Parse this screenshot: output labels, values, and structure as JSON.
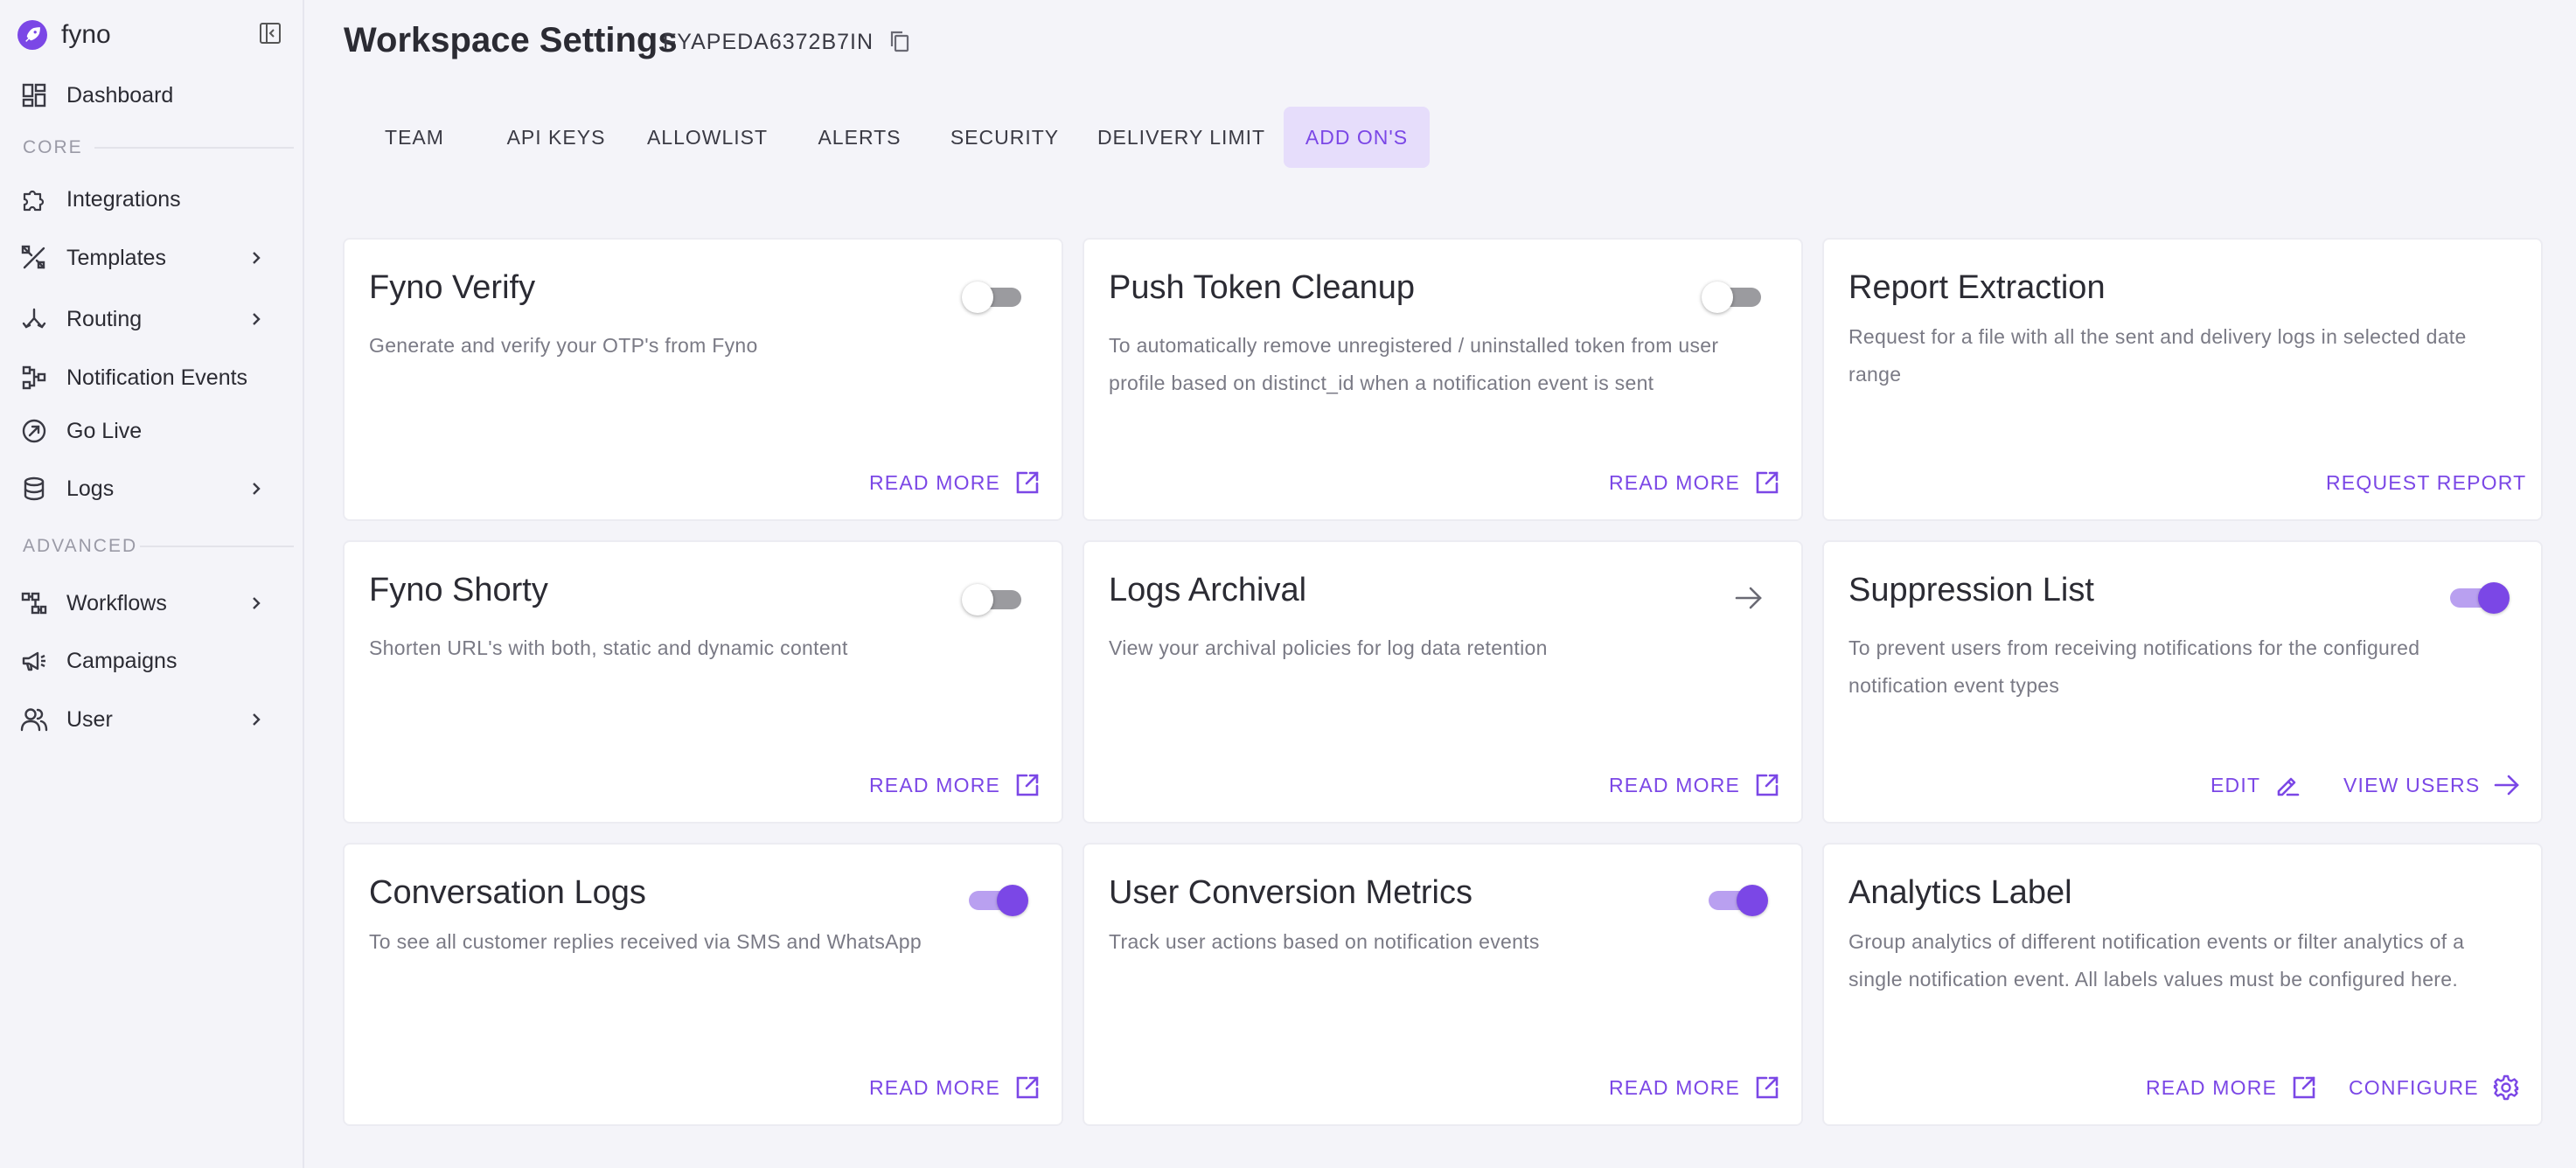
{
  "brand": {
    "name": "fyno"
  },
  "sidebar": {
    "items_core_header": "CORE",
    "items_advanced_header": "ADVANCED",
    "items": [
      {
        "label": "Dashboard",
        "icon": "dashboard-grid-icon"
      },
      {
        "label": "Integrations",
        "icon": "puzzle-icon"
      },
      {
        "label": "Templates",
        "icon": "tools-icon",
        "has_submenu": true
      },
      {
        "label": "Routing",
        "icon": "routing-fork-icon",
        "has_submenu": true
      },
      {
        "label": "Notification Events",
        "icon": "flow-icon"
      },
      {
        "label": "Go Live",
        "icon": "compass-arrow-icon"
      },
      {
        "label": "Logs",
        "icon": "database-icon",
        "has_submenu": true
      },
      {
        "label": "Workflows",
        "icon": "workflow-icon",
        "has_submenu": true
      },
      {
        "label": "Campaigns",
        "icon": "megaphone-icon"
      },
      {
        "label": "User",
        "icon": "users-icon",
        "has_submenu": true
      }
    ]
  },
  "header": {
    "title": "Workspace Settings",
    "workspace_id": "FYAPEDA6372B7IN"
  },
  "tabs": [
    {
      "label": "TEAM",
      "active": false
    },
    {
      "label": "API KEYS",
      "active": false
    },
    {
      "label": "ALLOWLIST",
      "active": false
    },
    {
      "label": "ALERTS",
      "active": false
    },
    {
      "label": "SECURITY",
      "active": false
    },
    {
      "label": "DELIVERY LIMIT",
      "active": false
    },
    {
      "label": "ADD ON'S",
      "active": true
    }
  ],
  "cards": [
    {
      "title": "Fyno Verify",
      "description": "Generate and verify your OTP's from Fyno",
      "toggle": false,
      "actions": [
        {
          "label": "READ MORE",
          "icon": "external-link-icon"
        }
      ]
    },
    {
      "title": "Push Token Cleanup",
      "description": "To automatically remove unregistered / uninstalled token from user profile based on distinct_id when a notification event is sent",
      "toggle": false,
      "actions": [
        {
          "label": "READ MORE",
          "icon": "external-link-icon"
        }
      ]
    },
    {
      "title": "Report Extraction",
      "description": "Request for a file with all the sent and delivery logs in selected date range",
      "actions": [
        {
          "label": "REQUEST REPORT"
        }
      ]
    },
    {
      "title": "Fyno Shorty",
      "description": "Shorten URL's with both, static and dynamic content",
      "toggle": false,
      "actions": [
        {
          "label": "READ MORE",
          "icon": "external-link-icon"
        }
      ]
    },
    {
      "title": "Logs Archival",
      "description": "View your archival policies for log data retention",
      "header_icon": "arrow-right-icon",
      "actions": [
        {
          "label": "READ MORE",
          "icon": "external-link-icon"
        }
      ]
    },
    {
      "title": "Suppression List",
      "description": "To prevent users from receiving notifications for the configured notification event types",
      "toggle": true,
      "actions": [
        {
          "label": "EDIT",
          "icon": "pencil-icon"
        },
        {
          "label": "VIEW USERS",
          "icon": "arrow-right-icon"
        }
      ]
    },
    {
      "title": "Conversation Logs",
      "description": "To see all customer replies received via SMS and WhatsApp",
      "toggle": true,
      "actions": [
        {
          "label": "READ MORE",
          "icon": "external-link-icon"
        }
      ]
    },
    {
      "title": "User Conversion Metrics",
      "description": "Track user actions based on notification events",
      "toggle": true,
      "actions": [
        {
          "label": "READ MORE",
          "icon": "external-link-icon"
        }
      ]
    },
    {
      "title": "Analytics Label",
      "description": "Group analytics of different notification events or filter analytics of a single notification event. All labels values must be configured here.",
      "actions": [
        {
          "label": "READ MORE",
          "icon": "external-link-icon"
        },
        {
          "label": "CONFIGURE",
          "icon": "gear-icon"
        }
      ]
    }
  ],
  "colors": {
    "accent": "#7b47e6",
    "accent_soft": "#e6ddfb",
    "background": "#f4f4f9",
    "card": "#ffffff",
    "text": "#2b2b33",
    "muted": "#7a7a85"
  }
}
